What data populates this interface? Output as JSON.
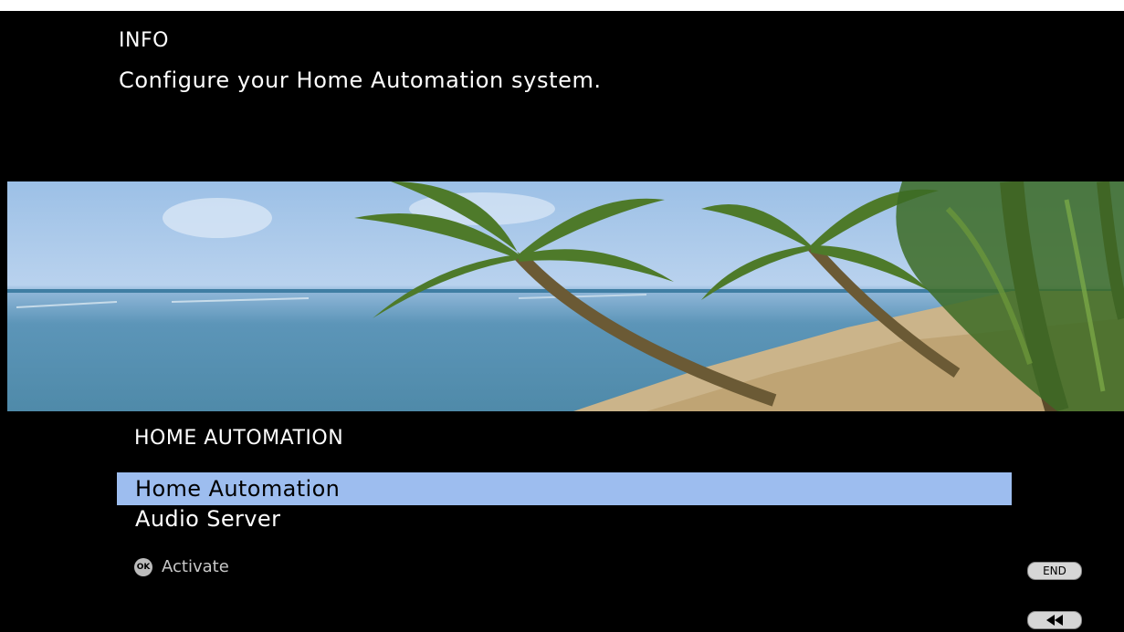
{
  "info": {
    "title": "INFO",
    "description": "Configure your Home Automation system."
  },
  "section": {
    "title": "HOME AUTOMATION"
  },
  "menu": {
    "items": [
      {
        "label": "Home Automation",
        "selected": true
      },
      {
        "label": "Audio Server",
        "selected": false
      }
    ]
  },
  "hint": {
    "ok_badge": "OK",
    "label": "Activate"
  },
  "buttons": {
    "end_label": "END",
    "back_icon": "rewind-icon"
  },
  "colors": {
    "selection": "#9dbdef",
    "background": "#000000"
  }
}
